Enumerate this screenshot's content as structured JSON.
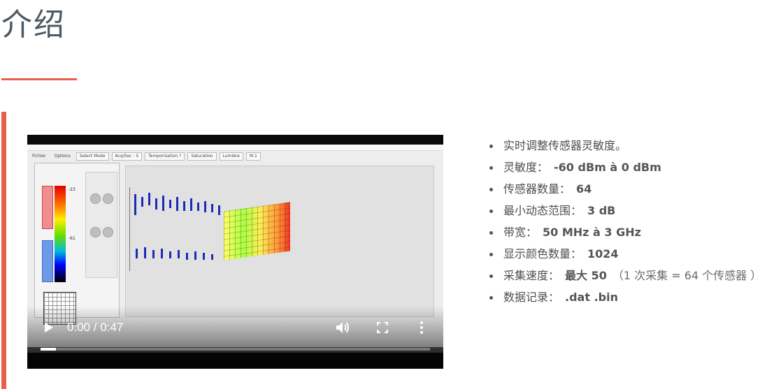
{
  "header": {
    "title": "介绍"
  },
  "video": {
    "time": "0:00 / 0:47",
    "progress": 0.04,
    "app": {
      "menu": [
        "Fichier",
        "Options",
        "Select Mode",
        "Acq/Sec : 5",
        "Temporisation ?",
        "Saturation",
        "Lumière",
        "M.1"
      ],
      "scale_top": "-23",
      "scale_bottom": "-61"
    }
  },
  "specs": [
    {
      "label": "实时调整传感器灵敏度。",
      "value": "",
      "note": ""
    },
    {
      "label": "灵敏度：",
      "value": "-60 dBm à 0 dBm",
      "note": ""
    },
    {
      "label": "传感器数量：",
      "value": "64",
      "note": ""
    },
    {
      "label": "最小动态范围：",
      "value": "3 dB",
      "note": ""
    },
    {
      "label": "带宽：",
      "value": "50 MHz à 3 GHz",
      "note": ""
    },
    {
      "label": "显示颜色数量：",
      "value": "1024",
      "note": ""
    },
    {
      "label": "采集速度：",
      "value": "最大 50",
      "note": "（1 次采集 = 64 个传感器 ）"
    },
    {
      "label": "数据记录：",
      "value": ".dat .bin",
      "note": ""
    }
  ],
  "colors": {
    "accent": "#e8604c",
    "title": "#4c5a63"
  }
}
